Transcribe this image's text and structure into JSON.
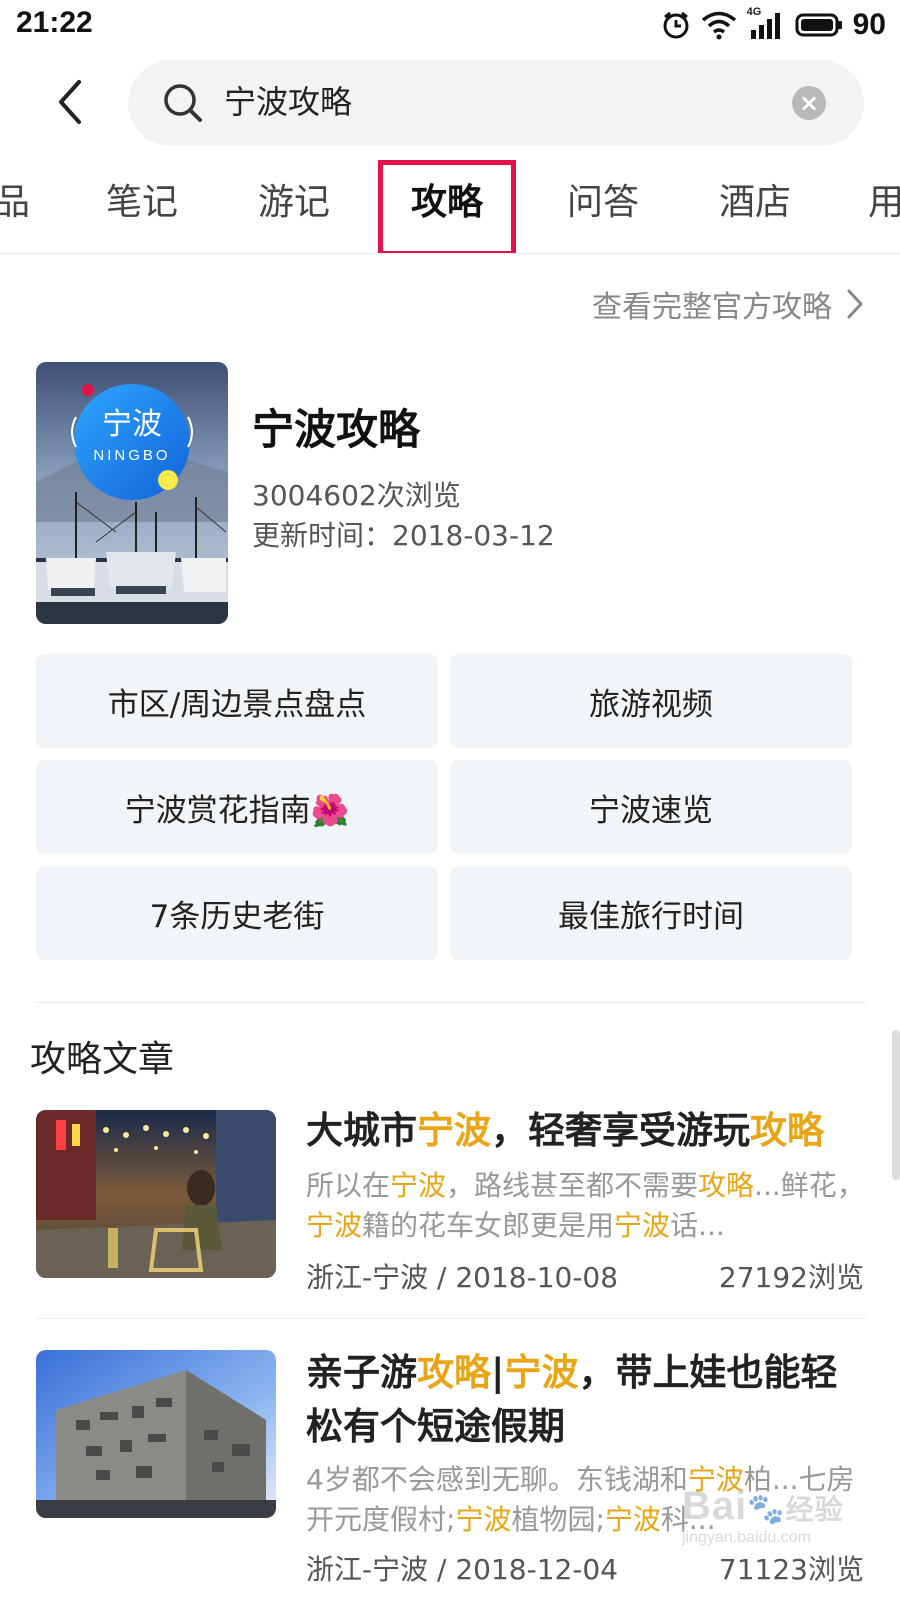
{
  "status_bar": {
    "time": "21:22",
    "battery": "90",
    "network": "4G",
    "icons": [
      "alarm-icon",
      "wifi-icon",
      "cellular-signal-icon",
      "battery-icon"
    ]
  },
  "header": {
    "back_icon": "chevron-left-icon",
    "search_icon": "search-icon",
    "search_query": "宁波攻略",
    "clear_icon": "clear-icon"
  },
  "tabs": [
    {
      "label": "品",
      "active": false
    },
    {
      "label": "笔记",
      "active": false
    },
    {
      "label": "游记",
      "active": false
    },
    {
      "label": "攻略",
      "active": true
    },
    {
      "label": "问答",
      "active": false
    },
    {
      "label": "酒店",
      "active": false
    },
    {
      "label": "用",
      "active": false
    }
  ],
  "full_guide_link": "查看完整官方攻略",
  "guide": {
    "cover_text_cn": "宁波",
    "cover_text_en": "NINGBO",
    "title": "宁波攻略",
    "views": "3004602次浏览",
    "updated": "更新时间：2018-03-12"
  },
  "guide_buttons": [
    "市区/周边景点盘点",
    "旅游视频",
    "宁波赏花指南🌺",
    "宁波速览",
    "7条历史老街",
    "最佳旅行时间"
  ],
  "section_title": "攻略文章",
  "articles": [
    {
      "title_parts": [
        {
          "text": "大城市",
          "hl": false
        },
        {
          "text": "宁波",
          "hl": true
        },
        {
          "text": "，轻奢享受游玩",
          "hl": false
        },
        {
          "text": "攻略",
          "hl": true
        }
      ],
      "snippet_parts": [
        {
          "text": "所以在",
          "hl": false
        },
        {
          "text": "宁波",
          "hl": true
        },
        {
          "text": "，路线甚至都不需要",
          "hl": false
        },
        {
          "text": "攻略",
          "hl": true
        },
        {
          "text": "...鲜花，",
          "hl": false
        },
        {
          "text": "宁波",
          "hl": true
        },
        {
          "text": "籍的花车女郎更是用",
          "hl": false
        },
        {
          "text": "宁波",
          "hl": true
        },
        {
          "text": "话...",
          "hl": false
        }
      ],
      "location_date": "浙江-宁波 / 2018-10-08",
      "views": "27192浏览"
    },
    {
      "title_parts": [
        {
          "text": "亲子游",
          "hl": false
        },
        {
          "text": "攻略",
          "hl": true
        },
        {
          "text": "|",
          "hl": false
        },
        {
          "text": "宁波",
          "hl": true
        },
        {
          "text": "，带上娃也能轻松有个短途假期",
          "hl": false
        }
      ],
      "snippet_parts": [
        {
          "text": "4岁都不会感到无聊。东钱湖和",
          "hl": false
        },
        {
          "text": "宁波",
          "hl": true
        },
        {
          "text": "柏...七房开元度假村;",
          "hl": false
        },
        {
          "text": "宁波",
          "hl": true
        },
        {
          "text": "植物园;",
          "hl": false
        },
        {
          "text": "宁波",
          "hl": true
        },
        {
          "text": "科...",
          "hl": false
        }
      ],
      "location_date": "浙江-宁波 / 2018-12-04",
      "views": "71123浏览"
    }
  ],
  "watermark": {
    "brand": "Bai",
    "brand_cn": "经验",
    "url": "jingyan.baidu.com"
  },
  "colors": {
    "highlight": "#e8a616",
    "tab_box": "#e5124a",
    "button_bg": "#f2f5f8"
  }
}
